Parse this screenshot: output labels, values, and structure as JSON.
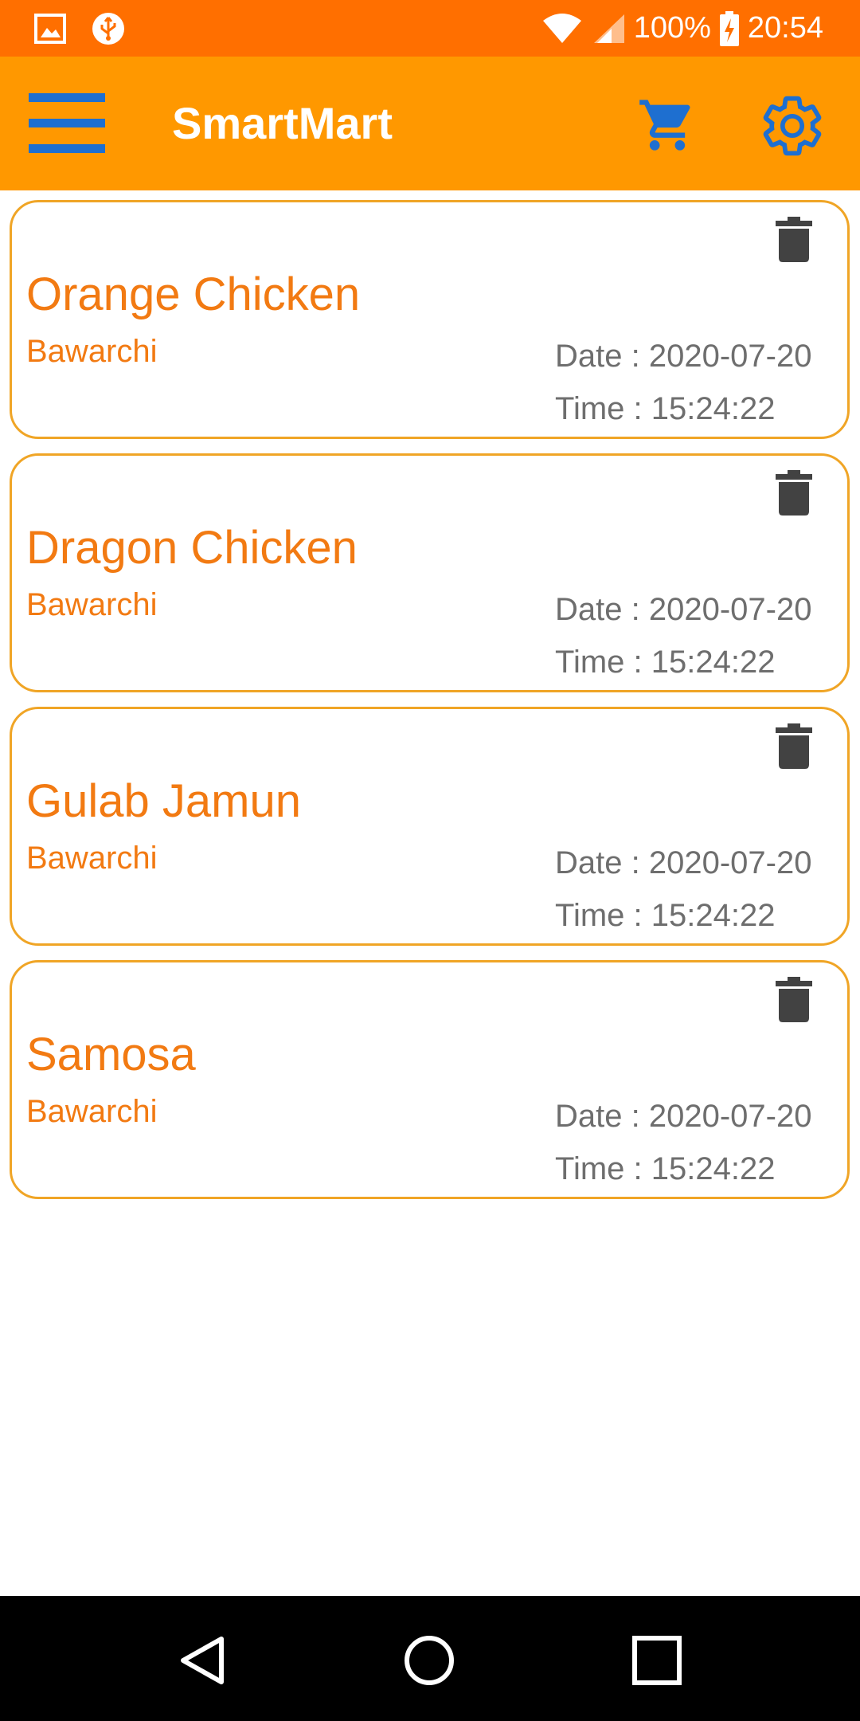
{
  "status_bar": {
    "battery": "100%",
    "time": "20:54",
    "icons": [
      "image-icon",
      "usb-icon",
      "wifi-icon",
      "signal-icon",
      "battery-charging-icon"
    ]
  },
  "app_bar": {
    "title": "SmartMart",
    "menu_icon": "hamburger-menu-icon",
    "cart_icon": "cart-icon",
    "settings_icon": "gear-icon",
    "accent_color": "#1e6fd0",
    "bar_color": "#ff9800"
  },
  "orders": [
    {
      "name": "Orange Chicken",
      "vendor": "Bawarchi",
      "date": "Date : 2020-07-20",
      "time": "Time : 15:24:22"
    },
    {
      "name": "Dragon Chicken",
      "vendor": "Bawarchi",
      "date": "Date : 2020-07-20",
      "time": "Time : 15:24:22"
    },
    {
      "name": "Gulab Jamun",
      "vendor": "Bawarchi",
      "date": "Date : 2020-07-20",
      "time": "Time : 15:24:22"
    },
    {
      "name": "Samosa",
      "vendor": "Bawarchi",
      "date": "Date : 2020-07-20",
      "time": "Time : 15:24:22"
    }
  ],
  "nav_bar": {
    "icons": [
      "back-icon",
      "home-icon",
      "recents-icon"
    ]
  }
}
